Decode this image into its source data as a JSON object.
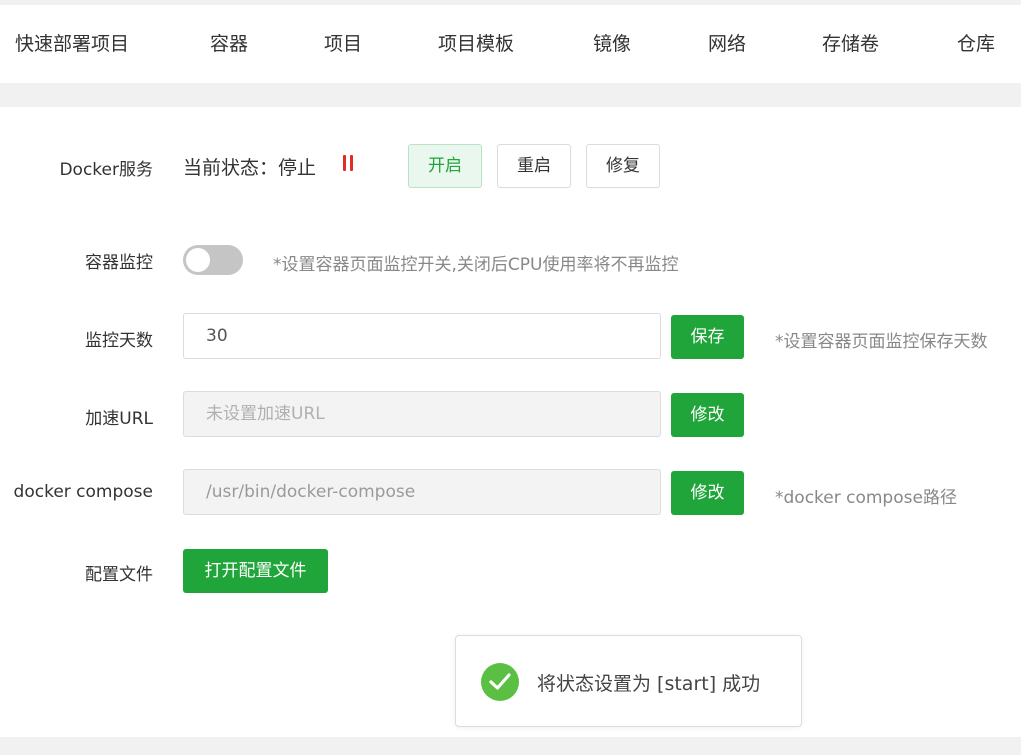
{
  "nav": {
    "tabs": [
      "快速部署项目",
      "容器",
      "项目",
      "项目模板",
      "镜像",
      "网络",
      "存储卷",
      "仓库"
    ]
  },
  "service": {
    "label": "Docker服务",
    "status_text": "当前状态：停止",
    "status_icon": "pause-icon",
    "status_color": "#e02e24",
    "buttons": {
      "start": "开启",
      "restart": "重启",
      "repair": "修复"
    }
  },
  "monitor": {
    "label": "容器监控",
    "enabled": false,
    "hint": "*设置容器页面监控开关,关闭后CPU使用率将不再监控"
  },
  "monitor_days": {
    "label": "监控天数",
    "value": "30",
    "save_label": "保存",
    "hint": "*设置容器页面监控保存天数"
  },
  "accel_url": {
    "label": "加速URL",
    "placeholder": "未设置加速URL",
    "modify_label": "修改"
  },
  "compose": {
    "label": "docker compose",
    "value": "/usr/bin/docker-compose",
    "modify_label": "修改",
    "hint": "*docker compose路径"
  },
  "config": {
    "label": "配置文件",
    "open_label": "打开配置文件"
  },
  "toast": {
    "icon": "check-circle-icon",
    "message": "将状态设置为 [start] 成功"
  },
  "colors": {
    "accent": "#20a53a",
    "danger": "#e02e24",
    "success_icon": "#5bbf44"
  }
}
